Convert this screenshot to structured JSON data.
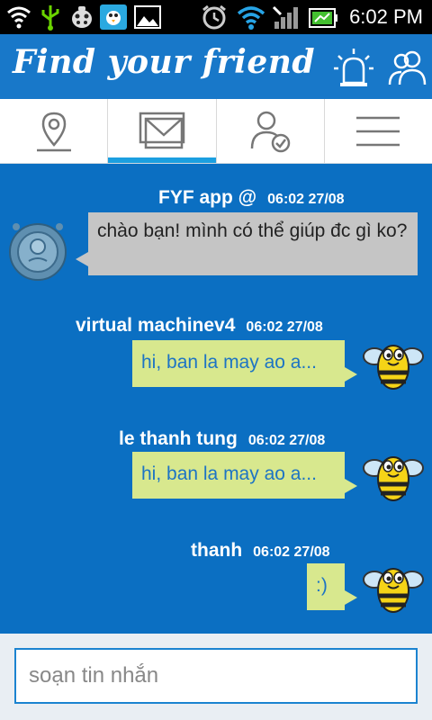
{
  "status_bar": {
    "time": "6:02 PM"
  },
  "app": {
    "title": "Find your friend"
  },
  "tabs": [
    {
      "name": "location"
    },
    {
      "name": "messages",
      "active": true
    },
    {
      "name": "contacts"
    },
    {
      "name": "menu"
    }
  ],
  "messages": [
    {
      "sender": "FYF app @",
      "time": "06:02 27/08",
      "text": "chào bạn! mình có thể giúp đc gì ko?",
      "direction": "incoming",
      "avatar": "robot-avatar"
    },
    {
      "sender": "virtual machinev4",
      "time": "06:02 27/08",
      "text": "hi, ban la may ao a...",
      "direction": "outgoing",
      "avatar": "bee-avatar"
    },
    {
      "sender": "le thanh tung",
      "time": "06:02 27/08",
      "text": "hi, ban la may ao a...",
      "direction": "outgoing",
      "avatar": "bee-avatar"
    },
    {
      "sender": "thanh",
      "time": "06:02 27/08",
      "text": ":)",
      "direction": "outgoing",
      "avatar": "bee-avatar"
    }
  ],
  "composer": {
    "placeholder": "soạn tin nhắn"
  },
  "colors": {
    "background": "#0b6fc2",
    "header": "#1878c9",
    "incoming_bubble": "#c5c5c5",
    "outgoing_bubble": "#d8e88e",
    "tab_indicator": "#1b9fe0"
  }
}
